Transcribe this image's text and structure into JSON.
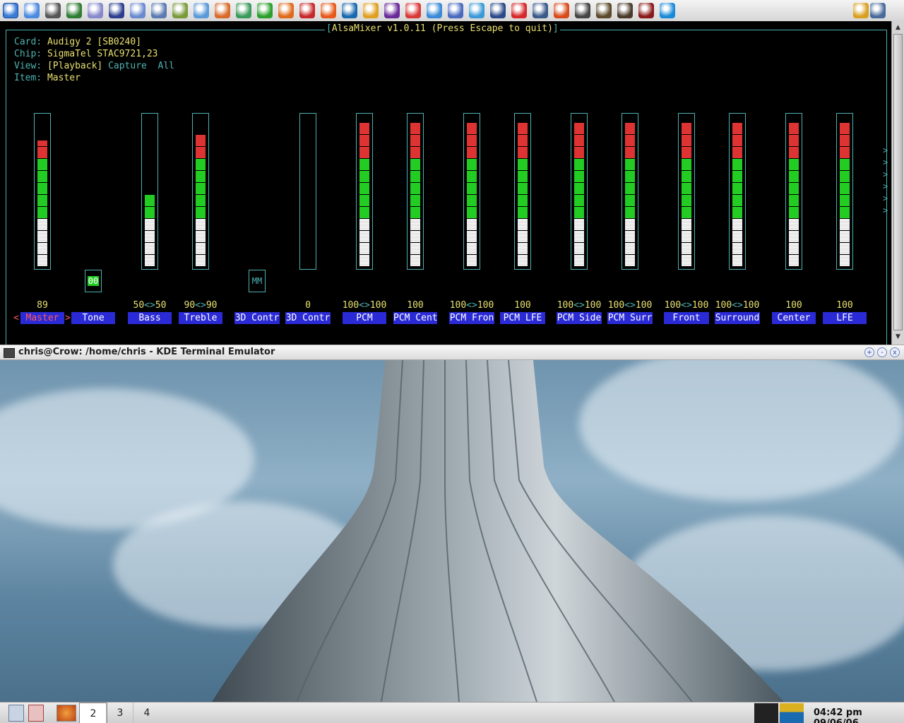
{
  "top_panel": {
    "launchers": [
      {
        "name": "kmenu-icon",
        "color": "#3a7bd5"
      },
      {
        "name": "drive-icon",
        "color": "#4a8ae0"
      },
      {
        "name": "monitor-icon",
        "color": "#555555"
      },
      {
        "name": "screen-icon",
        "color": "#2e7d32"
      },
      {
        "name": "printer-icon",
        "color": "#8888cc"
      },
      {
        "name": "chart-icon",
        "color": "#2c3e90"
      },
      {
        "name": "grid-icon",
        "color": "#6a8ad0"
      },
      {
        "name": "windows-icon",
        "color": "#5a7ab0"
      },
      {
        "name": "gpu-card-icon",
        "color": "#7a9a3a"
      },
      {
        "name": "molecule-icon",
        "color": "#5a9ad8"
      },
      {
        "name": "home-icon",
        "color": "#d86a2a"
      },
      {
        "name": "users-icon",
        "color": "#3a9a5a"
      },
      {
        "name": "skype-icon",
        "color": "#2aa02a"
      },
      {
        "name": "firefox-icon",
        "color": "#e06a1a"
      },
      {
        "name": "opera-icon",
        "color": "#c8282a"
      },
      {
        "name": "sunbird-icon",
        "color": "#e85a1a"
      },
      {
        "name": "globe-icon",
        "color": "#1a6ab0"
      },
      {
        "name": "jedit-icon",
        "color": "#e0a020"
      },
      {
        "name": "nvu-icon",
        "color": "#6a2a9a"
      },
      {
        "name": "chrome-like-icon",
        "color": "#d83a3a"
      },
      {
        "name": "paint-icon",
        "color": "#3a8ad8"
      },
      {
        "name": "tools-icon",
        "color": "#4a6ac0"
      },
      {
        "name": "notepad-icon",
        "color": "#3a9ad8"
      },
      {
        "name": "edit-icon",
        "color": "#2a4a8a"
      },
      {
        "name": "calc-icon",
        "color": "#d8282a"
      },
      {
        "name": "compass-icon",
        "color": "#3a5a8a"
      },
      {
        "name": "flame-icon",
        "color": "#d84a1a"
      },
      {
        "name": "cd-icon",
        "color": "#444444"
      },
      {
        "name": "shield-icon",
        "color": "#5a4a2a"
      },
      {
        "name": "bird-icon",
        "color": "#4a3a2a"
      },
      {
        "name": "game-icon",
        "color": "#8a1a1a"
      },
      {
        "name": "refresh-icon",
        "color": "#1a8ad8"
      }
    ],
    "tray": [
      {
        "name": "tray-user-icon",
        "color": "#d8a020"
      },
      {
        "name": "tray-network-icon",
        "color": "#4a6a9a"
      }
    ]
  },
  "terminal": {
    "title": "AlsaMixer v1.0.11 (Press Escape to quit)",
    "info": {
      "card_label": "Card:",
      "card_value": "Audigy 2 [SB0240]",
      "chip_label": "Chip:",
      "chip_value": "SigmaTel STAC9721,23",
      "view_label": "View:",
      "view_selected": "[Playback]",
      "view_capture": "Capture",
      "view_all": "All",
      "item_label": "Item:",
      "item_value": "Master"
    },
    "channels": [
      {
        "label": "Master",
        "value_left": "89",
        "value_right": "",
        "level": 0.89,
        "has_bar": true,
        "selected": true,
        "switch": null
      },
      {
        "label": "Tone",
        "value_left": "",
        "value_right": "",
        "level": null,
        "has_bar": false,
        "selected": false,
        "switch": "00"
      },
      {
        "label": "Bass",
        "value_left": "50",
        "value_right": "50",
        "level": 0.5,
        "has_bar": true,
        "selected": false,
        "switch": null
      },
      {
        "label": "Treble",
        "value_left": "90",
        "value_right": "90",
        "level": 0.9,
        "has_bar": true,
        "selected": false,
        "switch": null
      },
      {
        "label": "3D Contr",
        "value_left": "",
        "value_right": "",
        "level": null,
        "has_bar": false,
        "selected": false,
        "switch": "MM"
      },
      {
        "label": "3D Contr",
        "value_left": "0",
        "value_right": "",
        "level": 0.0,
        "has_bar": true,
        "selected": false,
        "switch": null
      },
      {
        "label": "PCM",
        "value_left": "100",
        "value_right": "100",
        "level": 1.0,
        "has_bar": true,
        "selected": false,
        "switch": null
      },
      {
        "label": "PCM Cent",
        "value_left": "100",
        "value_right": "",
        "level": 1.0,
        "has_bar": true,
        "selected": false,
        "switch": null
      },
      {
        "label": "PCM Fron",
        "value_left": "100",
        "value_right": "100",
        "level": 1.0,
        "has_bar": true,
        "selected": false,
        "switch": null
      },
      {
        "label": "PCM LFE",
        "value_left": "100",
        "value_right": "",
        "level": 1.0,
        "has_bar": true,
        "selected": false,
        "switch": null
      },
      {
        "label": "PCM Side",
        "value_left": "100",
        "value_right": "100",
        "level": 1.0,
        "has_bar": true,
        "selected": false,
        "switch": null
      },
      {
        "label": "PCM Surr",
        "value_left": "100",
        "value_right": "100",
        "level": 1.0,
        "has_bar": true,
        "selected": false,
        "switch": null
      },
      {
        "label": "Front",
        "value_left": "100",
        "value_right": "100",
        "level": 1.0,
        "has_bar": true,
        "selected": false,
        "switch": null
      },
      {
        "label": "Surround",
        "value_left": "100",
        "value_right": "100",
        "level": 1.0,
        "has_bar": true,
        "selected": false,
        "switch": null
      },
      {
        "label": "Center",
        "value_left": "100",
        "value_right": "",
        "level": 1.0,
        "has_bar": true,
        "selected": false,
        "switch": null
      },
      {
        "label": "LFE",
        "value_left": "100",
        "value_right": "",
        "level": 1.0,
        "has_bar": true,
        "selected": false,
        "switch": null
      }
    ],
    "more_marker": ">",
    "stereo_sep": "<>",
    "sel_left": "<",
    "sel_right": ">"
  },
  "window": {
    "title": "chris@Crow: /home/chris - KDE Terminal Emulator",
    "btn_max": "+",
    "btn_min": "-",
    "btn_close": "x"
  },
  "bottom_panel": {
    "desktops": [
      "2",
      "3",
      "4"
    ],
    "active_desktop": "2",
    "clock": "04:42 pm 09/06/06"
  },
  "colors": {
    "terminal_cyan": "#4fb3b3",
    "terminal_yellow": "#e8e070",
    "label_blue": "#2a2ad6",
    "meter_green": "#22cc22",
    "meter_red": "#dd3333"
  }
}
